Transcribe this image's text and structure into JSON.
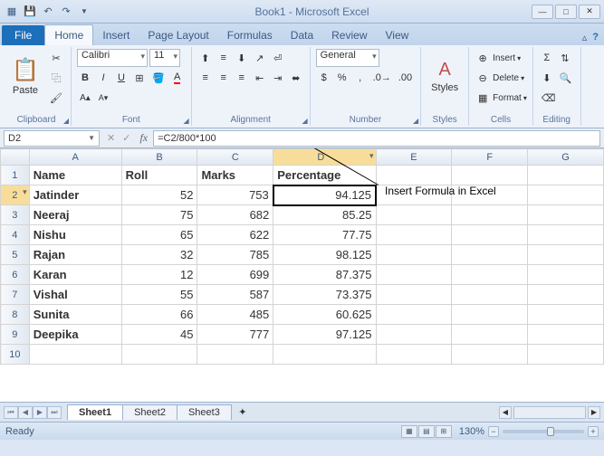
{
  "window": {
    "title": "Book1 - Microsoft Excel"
  },
  "tabs": {
    "file": "File",
    "items": [
      "Home",
      "Insert",
      "Page Layout",
      "Formulas",
      "Data",
      "Review",
      "View"
    ],
    "active": 0
  },
  "ribbon": {
    "clipboard": {
      "label": "Clipboard",
      "paste": "Paste"
    },
    "font": {
      "label": "Font",
      "family": "Calibri",
      "size": "11"
    },
    "alignment": {
      "label": "Alignment"
    },
    "number": {
      "label": "Number",
      "format": "General"
    },
    "styles": {
      "label": "Styles",
      "btn": "Styles"
    },
    "cells": {
      "label": "Cells",
      "insert": "Insert",
      "delete": "Delete",
      "format": "Format"
    },
    "editing": {
      "label": "Editing"
    }
  },
  "namebox": {
    "cell": "D2",
    "formula": "=C2/800*100"
  },
  "annotation": "Insert Formula in Excel",
  "sheet": {
    "columns": [
      "A",
      "B",
      "C",
      "D",
      "E",
      "F",
      "G"
    ],
    "headers": [
      "Name",
      "Roll",
      "Marks",
      "Percentage"
    ],
    "rows": [
      {
        "n": 1
      },
      {
        "n": 2,
        "a": "Jatinder",
        "b": 52,
        "c": 753,
        "d": "94.125"
      },
      {
        "n": 3,
        "a": "Neeraj",
        "b": 75,
        "c": 682,
        "d": "85.25"
      },
      {
        "n": 4,
        "a": "Nishu",
        "b": 65,
        "c": 622,
        "d": "77.75"
      },
      {
        "n": 5,
        "a": "Rajan",
        "b": 32,
        "c": 785,
        "d": "98.125"
      },
      {
        "n": 6,
        "a": "Karan",
        "b": 12,
        "c": 699,
        "d": "87.375"
      },
      {
        "n": 7,
        "a": "Vishal",
        "b": 55,
        "c": 587,
        "d": "73.375"
      },
      {
        "n": 8,
        "a": "Sunita",
        "b": 66,
        "c": 485,
        "d": "60.625"
      },
      {
        "n": 9,
        "a": "Deepika",
        "b": 45,
        "c": 777,
        "d": "97.125"
      },
      {
        "n": 10
      }
    ],
    "active": {
      "row": 2,
      "col": "D"
    }
  },
  "sheets": {
    "items": [
      "Sheet1",
      "Sheet2",
      "Sheet3"
    ],
    "active": 0
  },
  "status": {
    "text": "Ready",
    "zoom": "130%"
  }
}
